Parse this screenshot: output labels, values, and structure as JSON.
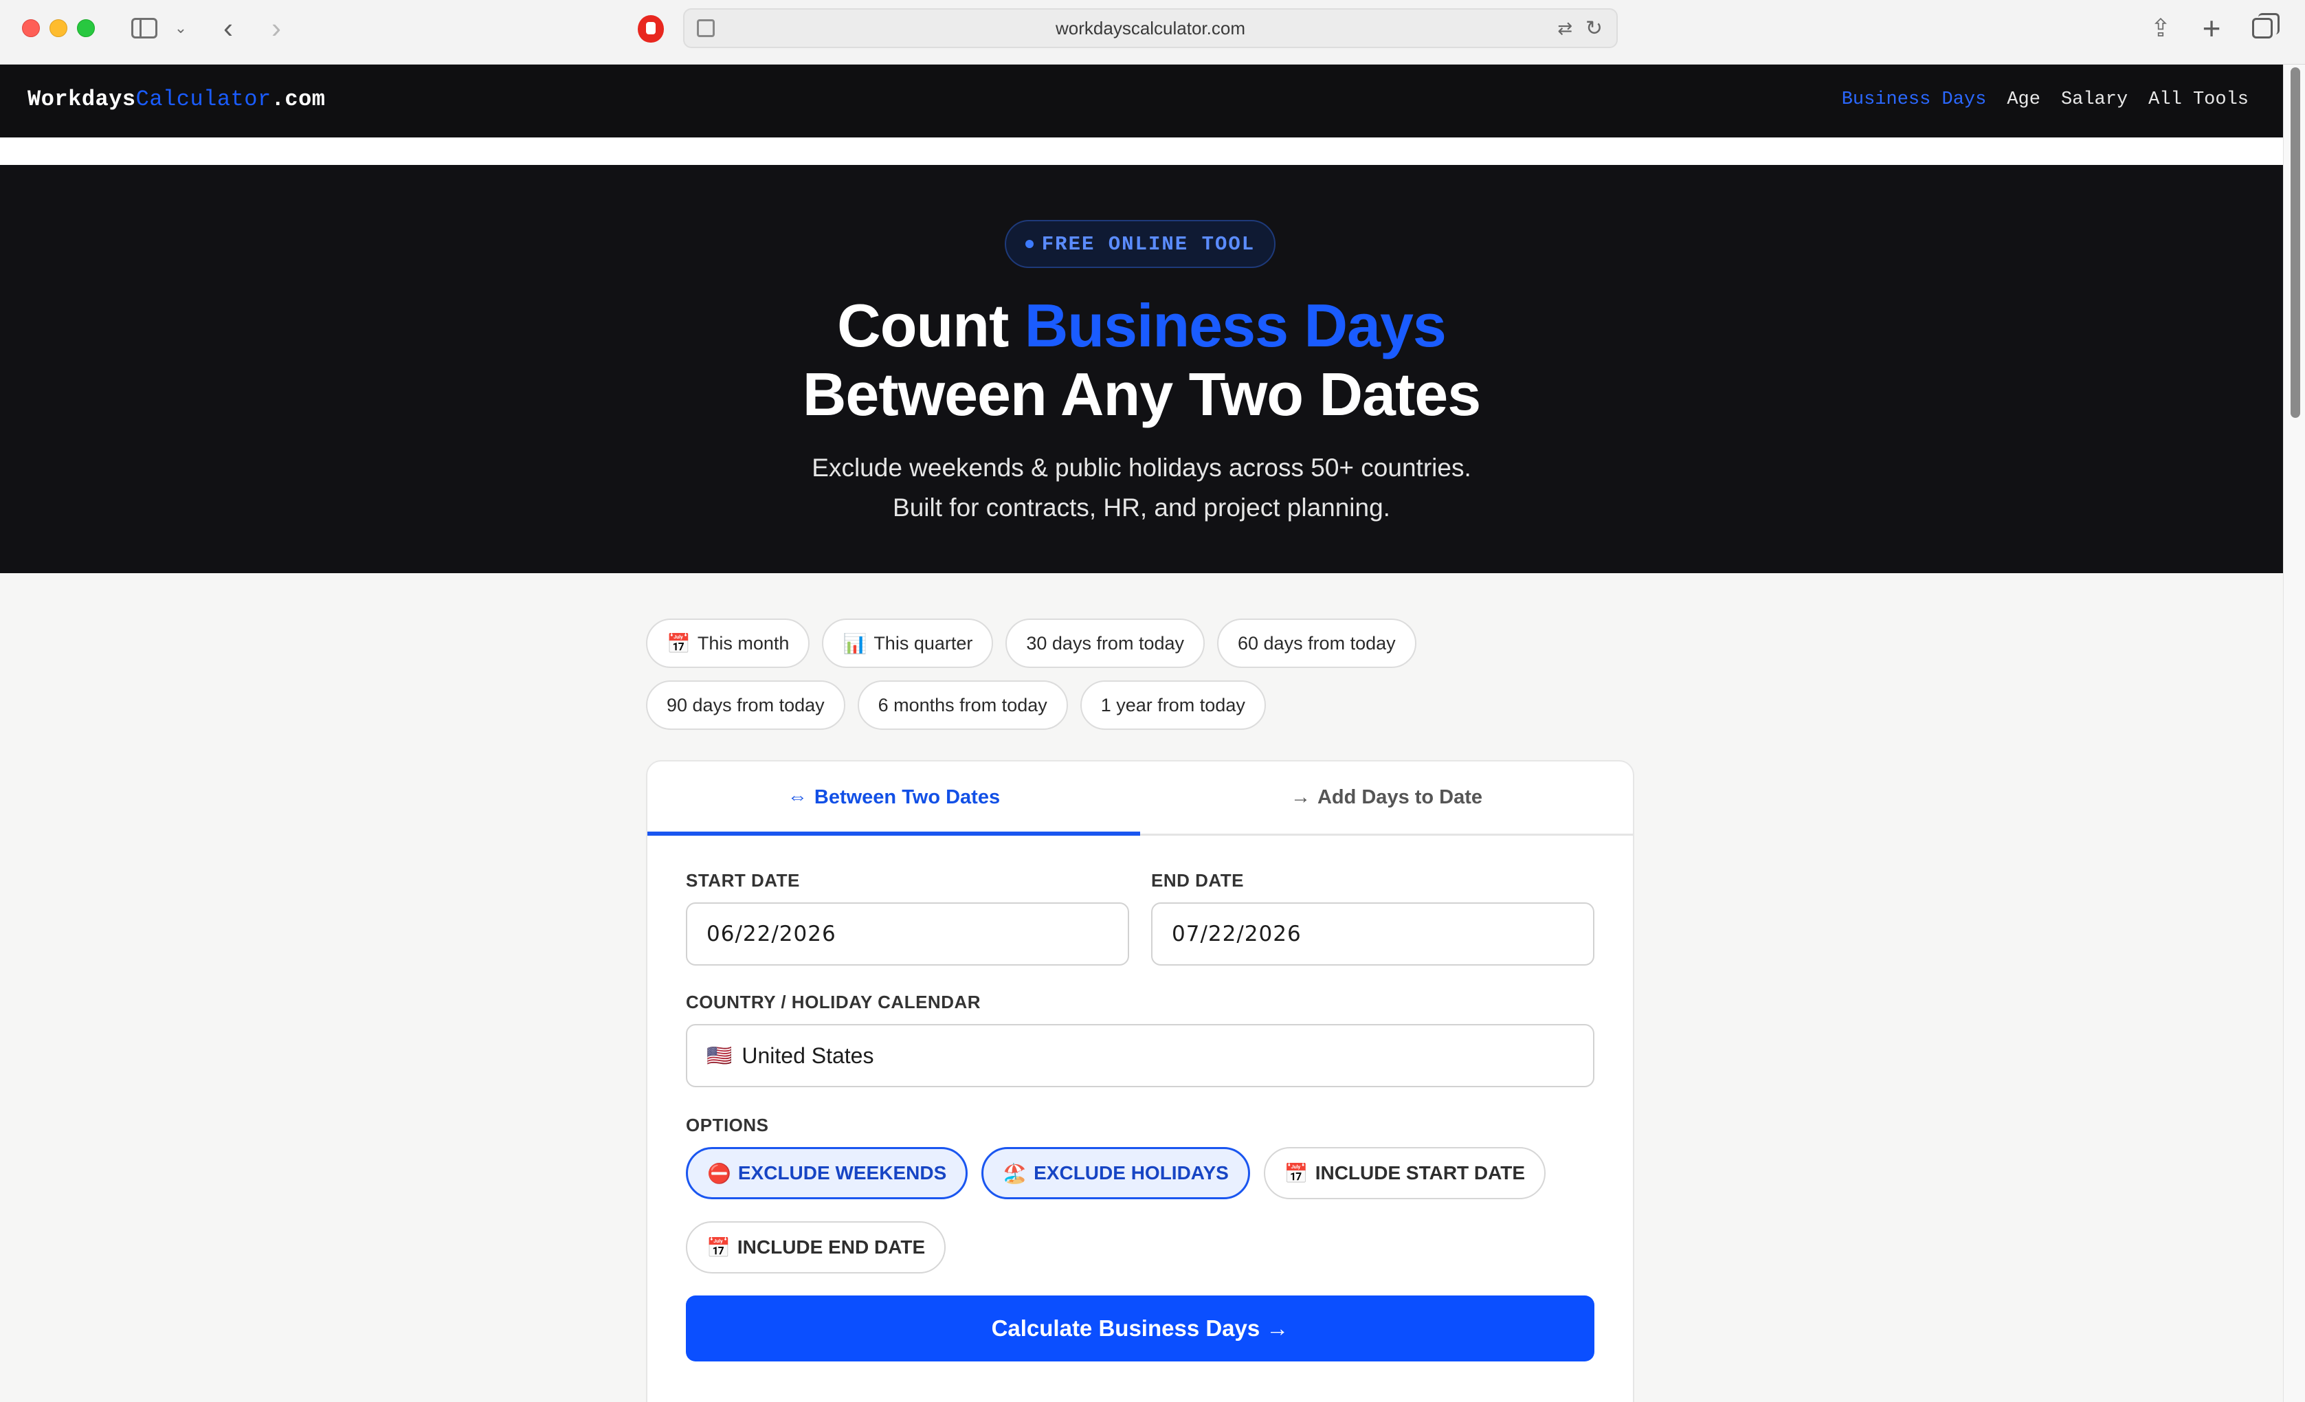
{
  "browser": {
    "url": "workdayscalculator.com",
    "icons": [
      "sidebar-icon",
      "chevron-down-icon",
      "back-icon",
      "forward-icon",
      "shield-icon",
      "page-settings-icon",
      "translate-icon",
      "reload-icon",
      "share-icon",
      "plus-icon",
      "tabs-overview-icon"
    ]
  },
  "site": {
    "logo_part1": "Workdays",
    "logo_part2": "Calculator",
    "logo_part3": ".com",
    "nav": [
      {
        "label": "Business Days",
        "active": true
      },
      {
        "label": "Age"
      },
      {
        "label": "Salary"
      },
      {
        "label": "All Tools"
      }
    ]
  },
  "hero": {
    "badge": "FREE ONLINE TOOL",
    "title_part1": "Count ",
    "title_accent": "Business Days",
    "title_line2": "Between Any Two Dates",
    "subtitle_line1": "Exclude weekends & public holidays across 50+ countries.",
    "subtitle_line2": "Built for contracts, HR, and project planning."
  },
  "presets": [
    {
      "emoji": "📅",
      "label": "This month"
    },
    {
      "emoji": "📊",
      "label": "This quarter"
    },
    {
      "label": "30 days from today"
    },
    {
      "label": "60 days from today"
    },
    {
      "label": "90 days from today"
    },
    {
      "label": "6 months from today"
    },
    {
      "label": "1 year from today"
    }
  ],
  "tabs": [
    {
      "glyph": "⇔",
      "label": "Between Two Dates",
      "active": true
    },
    {
      "glyph": "→",
      "label": "Add Days to Date"
    }
  ],
  "form": {
    "start_label": "START DATE",
    "start_value": "06/22/2026",
    "end_label": "END DATE",
    "end_value": "07/22/2026",
    "country_label": "COUNTRY / HOLIDAY CALENDAR",
    "country_flag": "🇺🇸",
    "country_value": "United States",
    "options_label": "OPTIONS",
    "options": [
      {
        "emoji": "⛔",
        "label": "EXCLUDE WEEKENDS",
        "on": true
      },
      {
        "emoji": "🏖️",
        "label": "EXCLUDE HOLIDAYS",
        "on": true
      },
      {
        "emoji": "📅",
        "label": "INCLUDE START DATE",
        "on": false
      },
      {
        "emoji": "📅",
        "label": "INCLUDE END DATE",
        "on": false
      }
    ],
    "submit_label": "Calculate Business Days →"
  },
  "colors": {
    "accent": "#1a5cff",
    "hero_bg": "#111114",
    "page_bg": "#f6f6f5"
  }
}
